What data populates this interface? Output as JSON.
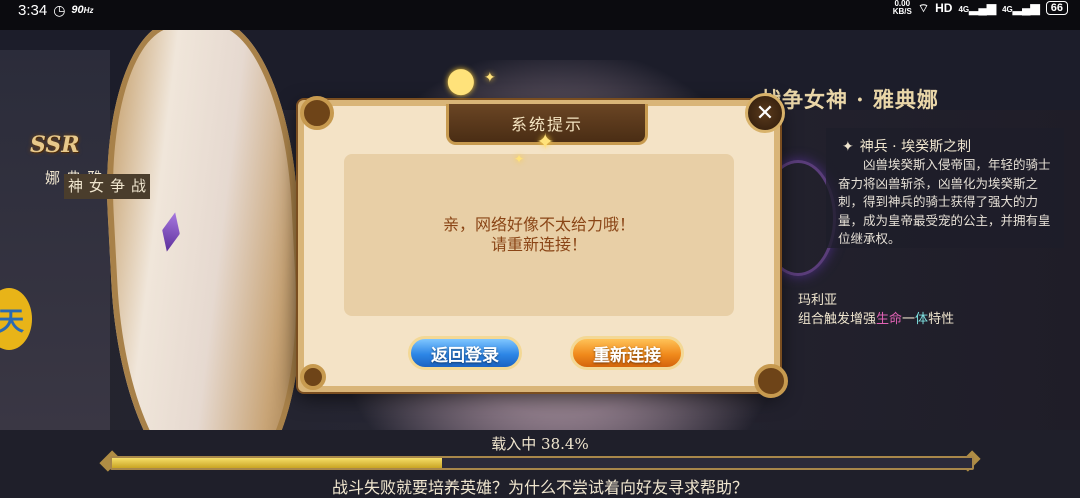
{
  "status_bar": {
    "time": "3:34",
    "refresh_rate": "90",
    "refresh_unit": "Hz",
    "net_speed": "0.00",
    "net_unit": "KB/S",
    "hd_label": "HD",
    "sig1_label": "4G",
    "sig2_label": "4G",
    "battery": "66"
  },
  "hero": {
    "rarity": "SSR",
    "name_vertical": "雅典娜",
    "title_vertical": "战争女神",
    "full_name": "战争女神 · 雅典娜",
    "side_tab_glyph": "天",
    "weapon_title": "神兵 · 埃癸斯之刺",
    "weapon_desc": "凶兽埃癸斯入侵帝国，年轻的骑士奋力将凶兽斩杀，凶兽化为埃癸斯之刺，得到神兵的骑士获得了强大的力量，成为皇帝最受宠的公主，并拥有皇位继承权。",
    "combo_partner": "玛利亚",
    "combo_prefix": "组合触发增强",
    "combo_hl1": "生命",
    "combo_hl2": "一",
    "combo_hl3": "体",
    "combo_suffix": "特性"
  },
  "dialog": {
    "title": "系统提示",
    "message_line1": "亲，网络好像不太给力哦！",
    "message_line2": "请重新连接！",
    "back_button": "返回登录",
    "retry_button": "重新连接",
    "close_glyph": "✕"
  },
  "loading": {
    "label": "载入中 38.4%",
    "progress": 0.384,
    "tip": "战斗失败就要培养英雄？为什么不尝试着向好友寻求帮助？"
  },
  "colors": {
    "dialog_bg": "#f4e3c6",
    "dialog_text": "#8a4516",
    "back_button": "#2d86e6",
    "retry_button": "#f08a1c",
    "progress_fill": "#e0c33e"
  }
}
